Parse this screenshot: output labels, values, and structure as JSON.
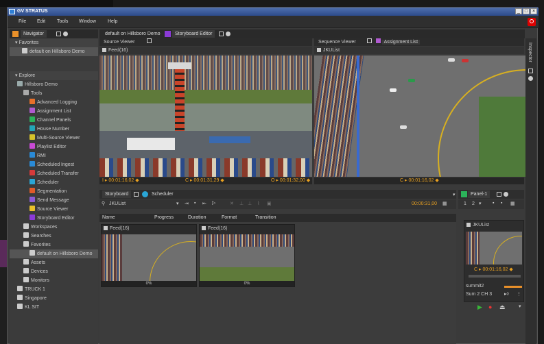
{
  "window": {
    "title": "GV STRATUS",
    "min": "_",
    "max": "□",
    "close": "×"
  },
  "menu": [
    "File",
    "Edit",
    "Tools",
    "Window",
    "Help"
  ],
  "navigator": {
    "tab": "Navigator",
    "favorites_header": "Favorites",
    "favorite_item": "default on Hillsboro Demo",
    "explore_header": "Explore",
    "tree": [
      {
        "label": "Hillsboro Demo",
        "indent": 1,
        "icon": "monitor",
        "color": "#9aa"
      },
      {
        "label": "Tools",
        "indent": 2,
        "icon": "wrench",
        "color": "#aaa"
      },
      {
        "label": "Advanced Logging",
        "indent": 3,
        "icon": "log",
        "color": "#e8702a"
      },
      {
        "label": "Assignment List",
        "indent": 3,
        "icon": "list",
        "color": "#b05ad0"
      },
      {
        "label": "Channel Panels",
        "indent": 3,
        "icon": "panel",
        "color": "#2bb35a"
      },
      {
        "label": "House Number",
        "indent": 3,
        "icon": "house",
        "color": "#23a6b8"
      },
      {
        "label": "Multi-Source Viewer",
        "indent": 3,
        "icon": "multi",
        "color": "#d6c22a"
      },
      {
        "label": "Playlist Editor",
        "indent": 3,
        "icon": "playlist",
        "color": "#c94ad6"
      },
      {
        "label": "RMI",
        "indent": 3,
        "icon": "rmi",
        "color": "#2a8ad6"
      },
      {
        "label": "Scheduled Ingest",
        "indent": 3,
        "icon": "clock",
        "color": "#2a8ad6"
      },
      {
        "label": "Scheduled Transfer",
        "indent": 3,
        "icon": "transfer",
        "color": "#d63a3a"
      },
      {
        "label": "Scheduler",
        "indent": 3,
        "icon": "scheduler",
        "color": "#2aa6d6"
      },
      {
        "label": "Segmentation",
        "indent": 3,
        "icon": "segment",
        "color": "#e05a2a"
      },
      {
        "label": "Send Message",
        "indent": 3,
        "icon": "message",
        "color": "#8a5ad6"
      },
      {
        "label": "Source Viewer",
        "indent": 3,
        "icon": "viewer",
        "color": "#e8c02a"
      },
      {
        "label": "Storyboard Editor",
        "indent": 3,
        "icon": "storyboard",
        "color": "#8a3ad6"
      },
      {
        "label": "Workspaces",
        "indent": 2,
        "icon": "folder",
        "color": "#ccc"
      },
      {
        "label": "Searches",
        "indent": 2,
        "icon": "folder",
        "color": "#ccc"
      },
      {
        "label": "Favorites",
        "indent": 2,
        "icon": "folder",
        "color": "#ccc"
      },
      {
        "label": "default on Hillsboro Demo",
        "indent": 3,
        "icon": "folder",
        "color": "#ccc",
        "selected": true
      },
      {
        "label": "Assets",
        "indent": 2,
        "icon": "assets",
        "color": "#ccc"
      },
      {
        "label": "Devices",
        "indent": 2,
        "icon": "devices",
        "color": "#ccc"
      },
      {
        "label": "Monitors",
        "indent": 2,
        "icon": "monitors",
        "color": "#ccc"
      },
      {
        "label": "TRUCK 1",
        "indent": 1,
        "icon": "truck",
        "color": "#ccc"
      },
      {
        "label": "Singapore",
        "indent": 1,
        "icon": "server",
        "color": "#ccc"
      },
      {
        "label": "KL SIT",
        "indent": 1,
        "icon": "server",
        "color": "#ccc"
      }
    ]
  },
  "tabs": {
    "default": "default on Hillsboro Demo",
    "storyboard_editor": "Storyboard Editor"
  },
  "source_viewer": {
    "title": "Source Viewer",
    "clip": "Feed(16)",
    "in": "I ▸ 00:01:16,02 ◆",
    "current": "C ▸ 00:01:31,29 ◆",
    "out": "O ▸ 00:01:32,00 ◆"
  },
  "sequence_viewer": {
    "title": "Sequence Viewer",
    "assignment_tab": "Assignment List",
    "clip": "JKUList",
    "current": "C ▸ 00:01:16,02 ◆"
  },
  "storyboard": {
    "tab": "Storyboard",
    "scheduler_tab": "Scheduler",
    "list_name": "JKUList",
    "duration": "00:00:31,00",
    "columns": [
      "Name",
      "Progress",
      "Duration",
      "Format",
      "Transition"
    ],
    "clips": [
      {
        "name": "Feed(16)",
        "progress": "0%"
      },
      {
        "name": "Feed(16)",
        "progress": "0%"
      }
    ]
  },
  "panel1": {
    "title": "Panel-1",
    "page1": "1",
    "page2": "2",
    "clip": "JKUList",
    "timecode": "C ▸ 00:01:16,02 ◆",
    "server": "summit2",
    "channel": "Sum 2 CH 3"
  },
  "inspector": {
    "label": "Inspector"
  }
}
